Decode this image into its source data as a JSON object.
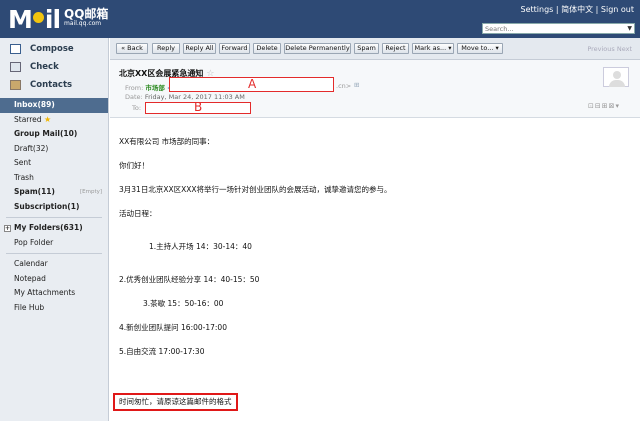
{
  "header": {
    "logo_text": "M  il",
    "logo_cn": "QQ邮箱",
    "logo_url": "mail.qq.com",
    "links": [
      "Settings",
      "简体中文",
      "Sign out"
    ],
    "search_placeholder": "Search..."
  },
  "sidebar": {
    "actions": [
      {
        "label": "Compose",
        "icon": "compose-icon"
      },
      {
        "label": "Check",
        "icon": "check-icon"
      },
      {
        "label": "Contacts",
        "icon": "contacts-icon"
      }
    ],
    "folders": [
      {
        "label": "Inbox(89)"
      },
      {
        "label": "Starred"
      },
      {
        "label": "Group Mail(10)"
      },
      {
        "label": "Draft(32)"
      },
      {
        "label": "Sent"
      },
      {
        "label": "Trash"
      },
      {
        "label": "Spam(11)",
        "extra": "[Empty]"
      },
      {
        "label": "Subscription(1)"
      }
    ],
    "my_folders": "My Folders(631)",
    "pop_folder": "Pop Folder",
    "tools": [
      "Calendar",
      "Notepad",
      "My Attachments",
      "File Hub"
    ]
  },
  "toolbar": {
    "buttons": [
      "« Back",
      "Reply",
      "Reply All",
      "Forward",
      "Delete",
      "Delete Permanently",
      "Spam",
      "Reject",
      "Mark as... ▾",
      "Move to... ▾"
    ],
    "pager": "Previous Next"
  },
  "mail": {
    "subject": "北京XX区会展紧急通知",
    "from_label": "From:",
    "from_name": "市场部",
    "from_suffix": ".cn>",
    "date_label": "Date:",
    "date": "Friday, Mar 24, 2017 11:03 AM",
    "to_label": "To:",
    "box_a": "A",
    "box_b": "B",
    "body": [
      "XX有限公司 市场部的同事：",
      "你们好！",
      "3月31日北京XX区XXX将举行一场针对创业团队的会展活动，诚挚邀请您的参与。",
      "活动日程：",
      "1.主持人开场  14：30-14：40",
      "2.优秀创业团队经验分享  14：40-15：50",
      "3.茶歇   15：50-16：00",
      "4.新创业团队提问 16:00-17:00",
      "5.自由交流 17:00-17:30"
    ],
    "note": "时间匆忙，请原谅这篇邮件的格式"
  }
}
